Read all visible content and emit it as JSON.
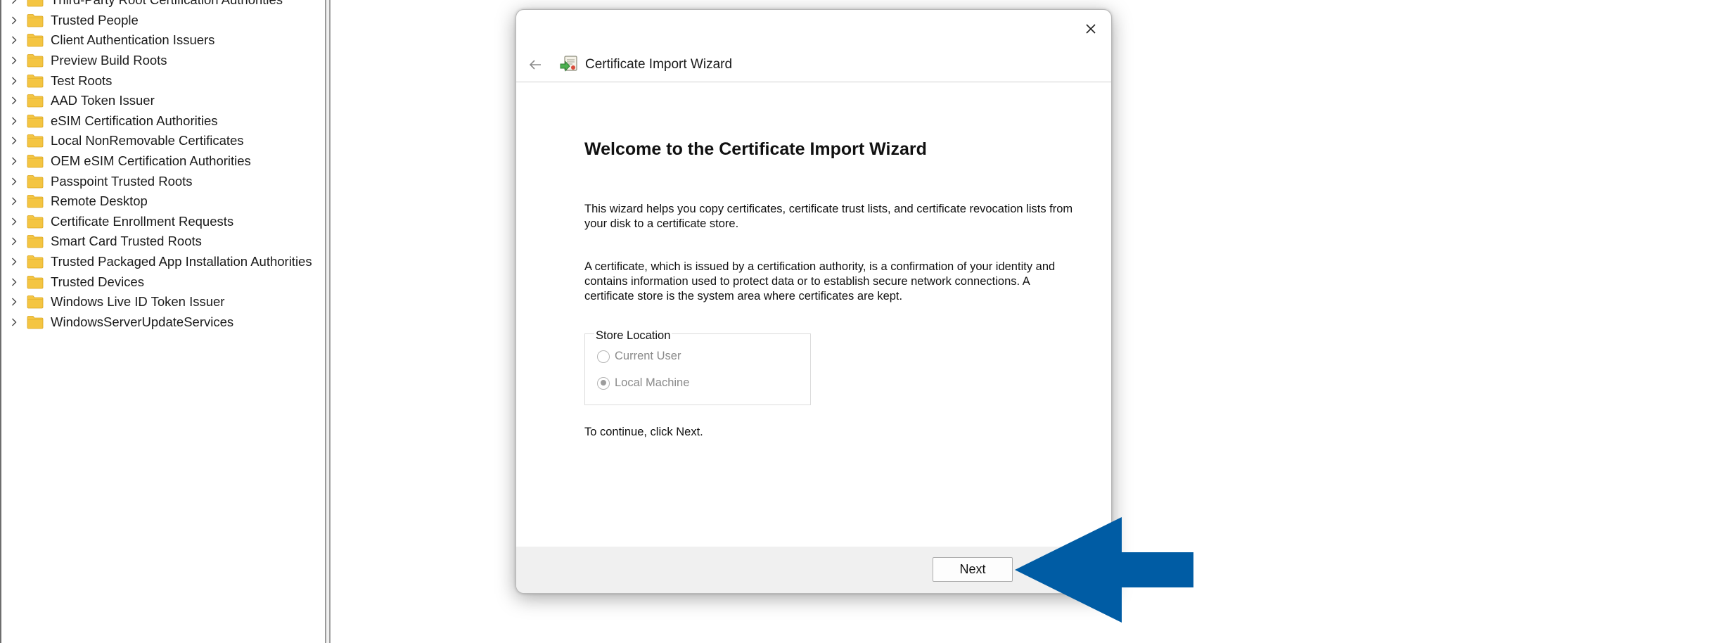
{
  "tree": {
    "items": [
      {
        "label": "Third-Party Root Certification Authorities"
      },
      {
        "label": "Trusted People"
      },
      {
        "label": "Client Authentication Issuers"
      },
      {
        "label": "Preview Build Roots"
      },
      {
        "label": "Test Roots"
      },
      {
        "label": "AAD Token Issuer"
      },
      {
        "label": "eSIM Certification Authorities"
      },
      {
        "label": "Local NonRemovable Certificates"
      },
      {
        "label": "OEM eSIM Certification Authorities"
      },
      {
        "label": "Passpoint Trusted Roots"
      },
      {
        "label": "Remote Desktop"
      },
      {
        "label": "Certificate Enrollment Requests"
      },
      {
        "label": "Smart Card Trusted Roots"
      },
      {
        "label": "Trusted Packaged App Installation Authorities"
      },
      {
        "label": "Trusted Devices"
      },
      {
        "label": "Windows Live ID Token Issuer"
      },
      {
        "label": "WindowsServerUpdateServices"
      }
    ]
  },
  "wizard": {
    "title": "Certificate Import Wizard",
    "heading": "Welcome to the Certificate Import Wizard",
    "paragraph_1": "This wizard helps you copy certificates, certificate trust lists, and certificate revocation lists from your disk to a certificate store.",
    "paragraph_2": "A certificate, which is issued by a certification authority, is a confirmation of your identity and contains information used to protect data or to establish secure network connections. A certificate store is the system area where certificates are kept.",
    "store_location": {
      "legend": "Store Location",
      "options": [
        {
          "label": "Current User",
          "selected": false,
          "enabled": false
        },
        {
          "label": "Local Machine",
          "selected": true,
          "enabled": false
        }
      ]
    },
    "continue_text": "To continue, click Next.",
    "next_label": "Next"
  },
  "annotation": {
    "arrow_color": "#005ca4",
    "points_to": "Next"
  },
  "colors": {
    "folder": "#f4c542",
    "footer_bg": "#f0f0f0",
    "disabled_text": "#8a8a8a"
  }
}
